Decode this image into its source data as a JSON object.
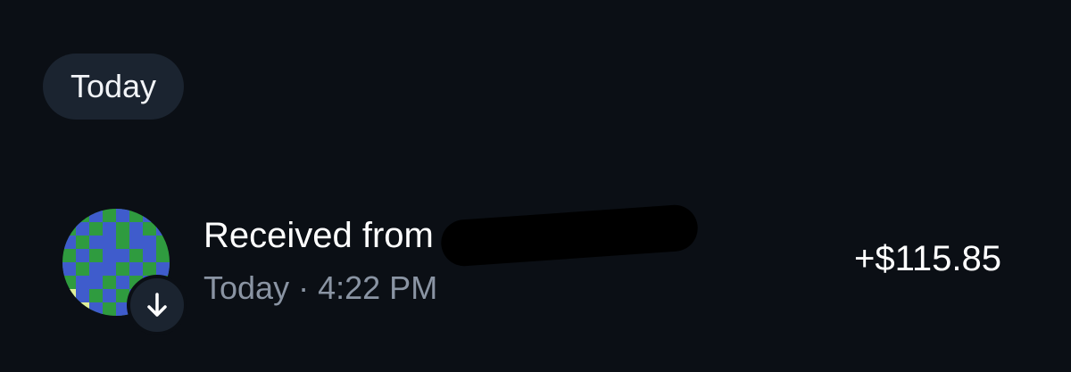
{
  "section": {
    "date_label": "Today"
  },
  "transaction": {
    "title": "Received from",
    "date": "Today",
    "separator": "·",
    "time": "4:22 PM",
    "amount": "+$115.85",
    "direction_icon": "arrow-down-icon",
    "avatar_icon": "pixel-identicon-icon",
    "avatar_colors": {
      "green": "#2f9b3f",
      "blue": "#3f5ccc",
      "yellow": "#dfee9a"
    },
    "badge_color": "#1b2430"
  },
  "colors": {
    "background": "#0b0f15",
    "chip_background": "#1b2430",
    "primary_text": "#ffffff",
    "secondary_text": "#8a94a3"
  }
}
